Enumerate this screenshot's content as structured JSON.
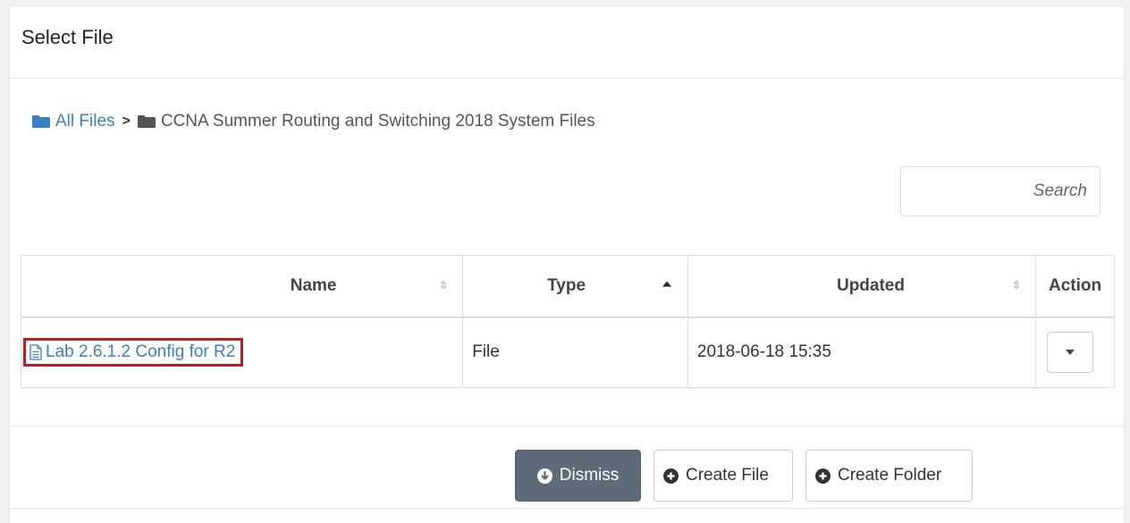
{
  "modal": {
    "title": "Select File"
  },
  "breadcrumb": {
    "root_label": "All Files",
    "separator": ">",
    "current_label": "CCNA Summer Routing and Switching 2018 System Files"
  },
  "search": {
    "placeholder": "Search",
    "value": ""
  },
  "table": {
    "columns": [
      {
        "label": "Name",
        "sort": "none"
      },
      {
        "label": "Type",
        "sort": "ascending"
      },
      {
        "label": "Updated",
        "sort": "none"
      },
      {
        "label": "Action",
        "sort": "none"
      }
    ],
    "rows": [
      {
        "name": "Lab 2.6.1.2 Config for R2",
        "type": "File",
        "updated": "2018-06-18 15:35",
        "highlighted": true
      }
    ]
  },
  "buttons": {
    "dismiss": "Dismiss",
    "create_file": "Create File",
    "create_folder": "Create Folder"
  },
  "icons": {
    "breadcrumb_root": "folder-icon",
    "breadcrumb_current": "folder-icon",
    "file": "document-icon",
    "dismiss": "arrow-circle-down-icon",
    "create": "plus-circle-icon"
  },
  "colors": {
    "link": "#3a7fc1",
    "highlight_border": "#b41f24",
    "dismiss_bg": "#5d6a78"
  }
}
